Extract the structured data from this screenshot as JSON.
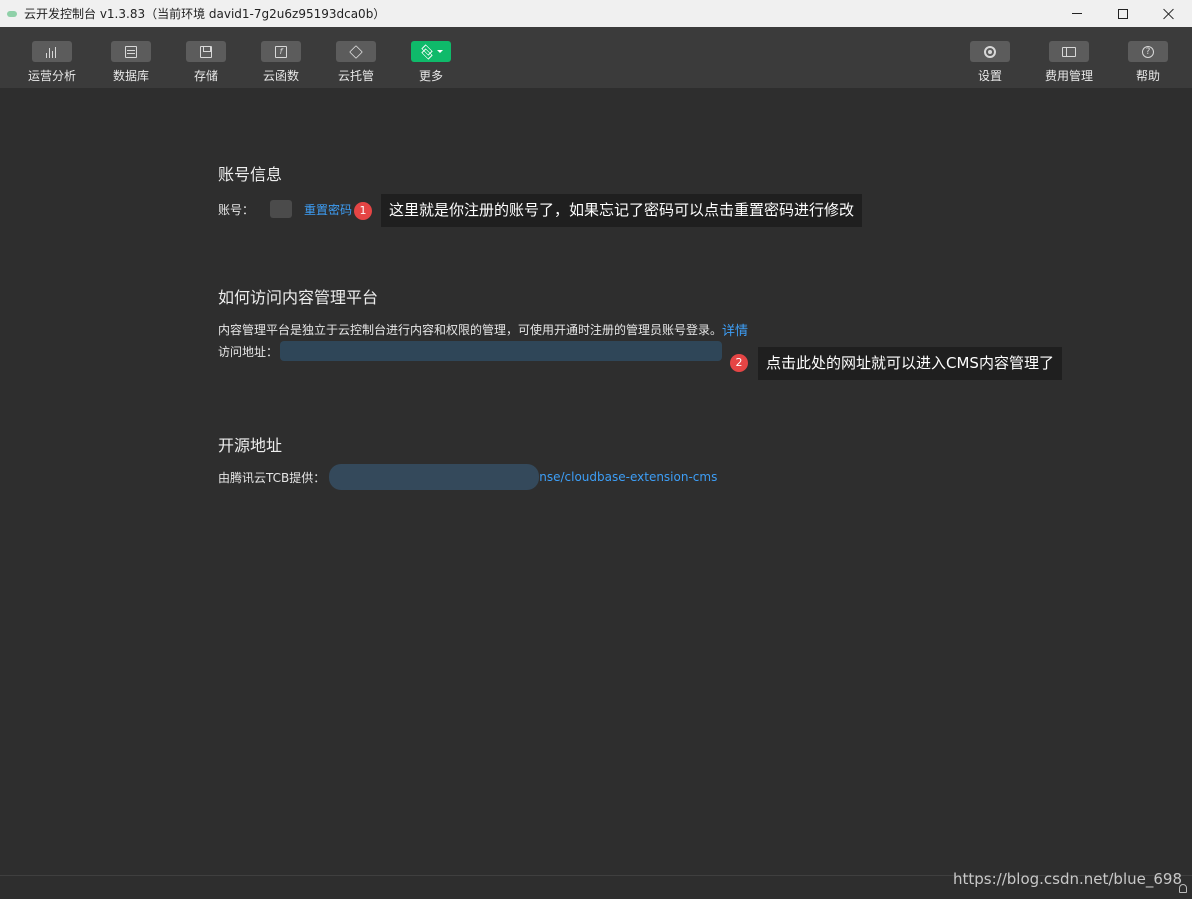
{
  "window": {
    "title": "云开发控制台 v1.3.83（当前环境 david1-7g2u6z95193dca0b）"
  },
  "toolbar": {
    "left": [
      {
        "icon": "bar-chart-icon",
        "label": "运营分析"
      },
      {
        "icon": "database-icon",
        "label": "数据库"
      },
      {
        "icon": "storage-icon",
        "label": "存储"
      },
      {
        "icon": "cloud-function-icon",
        "label": "云函数"
      },
      {
        "icon": "cloud-hosting-icon",
        "label": "云托管"
      },
      {
        "icon": "layers-icon",
        "label": "更多"
      }
    ],
    "right": [
      {
        "icon": "gear-icon",
        "label": "设置"
      },
      {
        "icon": "billing-icon",
        "label": "费用管理"
      },
      {
        "icon": "help-icon",
        "label": "帮助"
      }
    ]
  },
  "account": {
    "heading": "账号信息",
    "label": "账号：",
    "reset_link": "重置密码",
    "badge": "1",
    "callout": "这里就是你注册的账号了，如果忘记了密码可以点击重置密码进行修改"
  },
  "cms": {
    "heading": "如何访问内容管理平台",
    "description": "内容管理平台是独立于云控制台进行内容和权限的管理，可使用开通时注册的管理员账号登录。",
    "details_link": "详情",
    "address_label": "访问地址：",
    "badge": "2",
    "callout": "点击此处的网址就可以进入CMS内容管理了"
  },
  "opensource": {
    "heading": "开源地址",
    "provider_label": "由腾讯云TCB提供：",
    "link_visible": "nse/cloudbase-extension-cms"
  },
  "watermark": "https://blog.csdn.net/blue_698",
  "colors": {
    "background": "#2e2e2e",
    "toolbar": "#3b3b3b",
    "link": "#3d9ef6",
    "accent_green": "#0fba6a",
    "badge_red": "#e54545"
  }
}
